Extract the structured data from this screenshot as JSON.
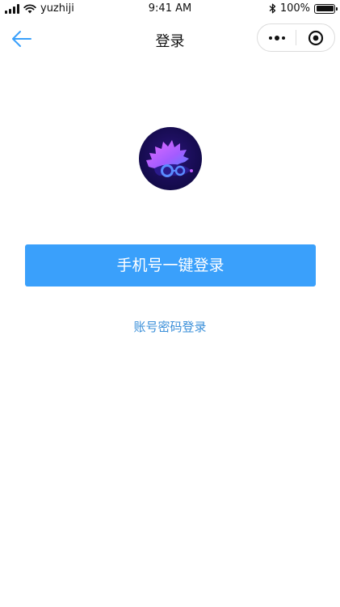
{
  "status_bar": {
    "carrier": "yuzhiji",
    "time": "9:41 AM",
    "battery_text": "100%",
    "icons": [
      "signal-icon",
      "wifi-icon",
      "bluetooth-icon",
      "battery-icon"
    ]
  },
  "nav": {
    "title": "登录",
    "back_icon": "arrow-left-icon",
    "capsule_icons": [
      "more-dots-icon",
      "target-circle-icon"
    ]
  },
  "logo": {
    "icon": "hedgehog-logo",
    "colors": {
      "bg": "#1b0f5a",
      "accent": "#c15cff",
      "accent2": "#5a8bff"
    }
  },
  "actions": {
    "one_click_login": "手机号一键登录",
    "password_login": "账号密码登录"
  },
  "colors": {
    "primary": "#3aa0fb",
    "link": "#3a8fd9",
    "back_arrow": "#3aa0fb"
  }
}
